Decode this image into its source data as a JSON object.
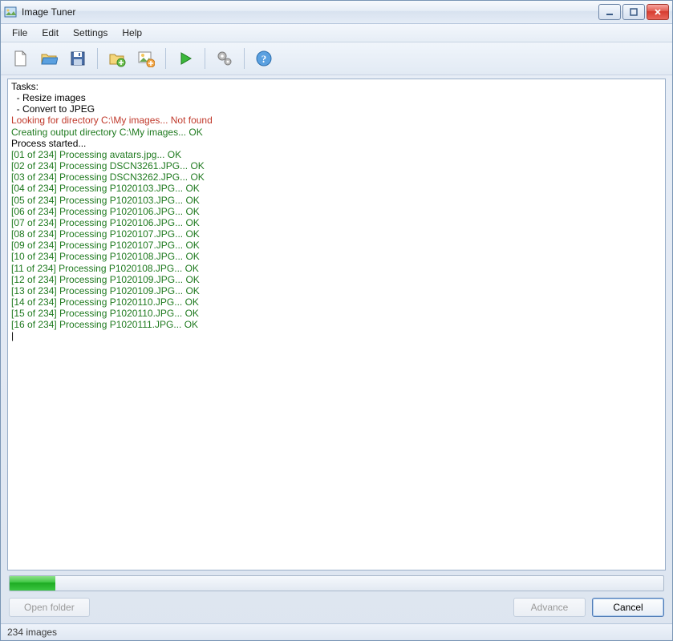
{
  "title": "Image Tuner",
  "menu": {
    "file": "File",
    "edit": "Edit",
    "settings": "Settings",
    "help": "Help"
  },
  "toolbar": {
    "new": "new-file-icon",
    "open": "open-folder-icon",
    "save": "save-icon",
    "add_folder": "add-folder-icon",
    "add_image": "add-image-icon",
    "run": "play-icon",
    "settings": "gears-icon",
    "help": "help-icon"
  },
  "log": {
    "tasks_header": "Tasks:",
    "task_lines": [
      "  - Resize images",
      "  - Convert to JPEG"
    ],
    "error_line": "Looking for directory C:\\My images... Not found",
    "ok_line": "Creating output directory C:\\My images... OK",
    "process_started": "Process started...",
    "entries": [
      "[01 of 234] Processing avatars.jpg... OK",
      "[02 of 234] Processing DSCN3261.JPG... OK",
      "[03 of 234] Processing DSCN3262.JPG... OK",
      "[04 of 234] Processing P1020103.JPG... OK",
      "[05 of 234] Processing P1020103.JPG... OK",
      "[06 of 234] Processing P1020106.JPG... OK",
      "[07 of 234] Processing P1020106.JPG... OK",
      "[08 of 234] Processing P1020107.JPG... OK",
      "[09 of 234] Processing P1020107.JPG... OK",
      "[10 of 234] Processing P1020108.JPG... OK",
      "[11 of 234] Processing P1020108.JPG... OK",
      "[12 of 234] Processing P1020109.JPG... OK",
      "[13 of 234] Processing P1020109.JPG... OK",
      "[14 of 234] Processing P1020110.JPG... OK",
      "[15 of 234] Processing P1020110.JPG... OK",
      "[16 of 234] Processing P1020111.JPG... OK"
    ]
  },
  "progress_percent": 7,
  "buttons": {
    "open_folder": "Open folder",
    "advance": "Advance",
    "cancel": "Cancel"
  },
  "status": "234 images"
}
